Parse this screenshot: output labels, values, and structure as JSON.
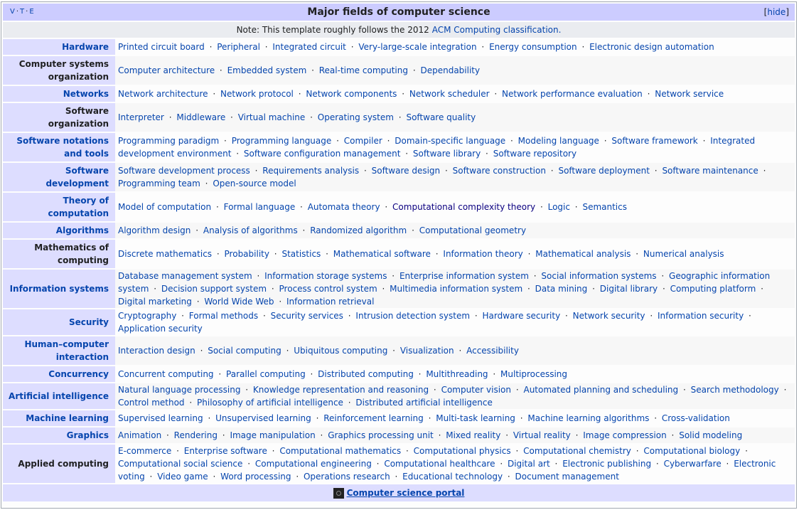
{
  "title": "Major fields of computer science",
  "vte": [
    "V",
    "T",
    "E"
  ],
  "hide_label": "hide",
  "note_text": "Note: This template roughly follows the 2012",
  "note_link": "ACM Computing classification.",
  "footer_link": "Computer science portal",
  "rows": [
    {
      "group": "Hardware",
      "group_is_link": true,
      "items": [
        "Printed circuit board",
        "Peripheral",
        "Integrated circuit",
        "Very-large-scale integration",
        "Energy consumption",
        "Electronic design automation"
      ]
    },
    {
      "group": "Computer systems organization",
      "group_is_link": false,
      "items": [
        "Computer architecture",
        "Embedded system",
        "Real-time computing",
        "Dependability"
      ]
    },
    {
      "group": "Networks",
      "group_is_link": true,
      "items": [
        "Network architecture",
        "Network protocol",
        "Network components",
        "Network scheduler",
        "Network performance evaluation",
        "Network service"
      ]
    },
    {
      "group": "Software organization",
      "group_is_link": false,
      "items": [
        "Interpreter",
        "Middleware",
        "Virtual machine",
        "Operating system",
        "Software quality"
      ]
    },
    {
      "group": "Software notations and tools",
      "group_is_link": true,
      "items": [
        "Programming paradigm",
        "Programming language",
        "Compiler",
        "Domain-specific language",
        "Modeling language",
        "Software framework",
        "Integrated development environment",
        "Software configuration management",
        "Software library",
        "Software repository"
      ]
    },
    {
      "group": "Software development",
      "group_is_link": true,
      "items": [
        "Software development process",
        "Requirements analysis",
        "Software design",
        "Software construction",
        "Software deployment",
        "Software maintenance",
        "Programming team",
        "Open-source model"
      ]
    },
    {
      "group": "Theory of computation",
      "group_is_link": true,
      "items": [
        "Model of computation",
        "Formal language",
        "Automata theory",
        "Computational complexity theory",
        "Logic",
        "Semantics"
      ]
    },
    {
      "group": "Algorithms",
      "group_is_link": true,
      "items": [
        "Algorithm design",
        "Analysis of algorithms",
        "Randomized algorithm",
        "Computational geometry"
      ]
    },
    {
      "group": "Mathematics of computing",
      "group_is_link": false,
      "items": [
        "Discrete mathematics",
        "Probability",
        "Statistics",
        "Mathematical software",
        "Information theory",
        "Mathematical analysis",
        "Numerical analysis"
      ]
    },
    {
      "group": "Information systems",
      "group_is_link": true,
      "items": [
        "Database management system",
        "Information storage systems",
        "Enterprise information system",
        "Social information systems",
        "Geographic information system",
        "Decision support system",
        "Process control system",
        "Multimedia information system",
        "Data mining",
        "Digital library",
        "Computing platform",
        "Digital marketing",
        "World Wide Web",
        "Information retrieval"
      ]
    },
    {
      "group": "Security",
      "group_is_link": true,
      "items": [
        "Cryptography",
        "Formal methods",
        "Security services",
        "Intrusion detection system",
        "Hardware security",
        "Network security",
        "Information security",
        "Application security"
      ]
    },
    {
      "group": "Human–computer interaction",
      "group_is_link": true,
      "items": [
        "Interaction design",
        "Social computing",
        "Ubiquitous computing",
        "Visualization",
        "Accessibility"
      ]
    },
    {
      "group": "Concurrency",
      "group_is_link": true,
      "items": [
        "Concurrent computing",
        "Parallel computing",
        "Distributed computing",
        "Multithreading",
        "Multiprocessing"
      ]
    },
    {
      "group": "Artificial intelligence",
      "group_is_link": true,
      "items": [
        "Natural language processing",
        "Knowledge representation and reasoning",
        "Computer vision",
        "Automated planning and scheduling",
        "Search methodology",
        "Control method",
        "Philosophy of artificial intelligence",
        "Distributed artificial intelligence"
      ]
    },
    {
      "group": "Machine learning",
      "group_is_link": true,
      "items": [
        "Supervised learning",
        "Unsupervised learning",
        "Reinforcement learning",
        "Multi-task learning",
        "Machine learning algorithms",
        "Cross-validation"
      ]
    },
    {
      "group": "Graphics",
      "group_is_link": true,
      "items": [
        "Animation",
        "Rendering",
        "Image manipulation",
        "Graphics processing unit",
        "Mixed reality",
        "Virtual reality",
        "Image compression",
        "Solid modeling"
      ]
    },
    {
      "group": "Applied computing",
      "group_is_link": false,
      "items": [
        "E-commerce",
        "Enterprise software",
        "Computational mathematics",
        "Computational physics",
        "Computational chemistry",
        "Computational biology",
        "Computational social science",
        "Computational engineering",
        "Computational healthcare",
        "Digital art",
        "Electronic publishing",
        "Cyberwarfare",
        "Electronic voting",
        "Video game",
        "Word processing",
        "Operations research",
        "Educational technology",
        "Document management"
      ]
    }
  ],
  "colors": {
    "title_bg": "#ccccff",
    "group_bg": "#ddddff",
    "note_bg": "#eaecf0",
    "link": "#0645ad",
    "visited_link": "#0b0080"
  }
}
